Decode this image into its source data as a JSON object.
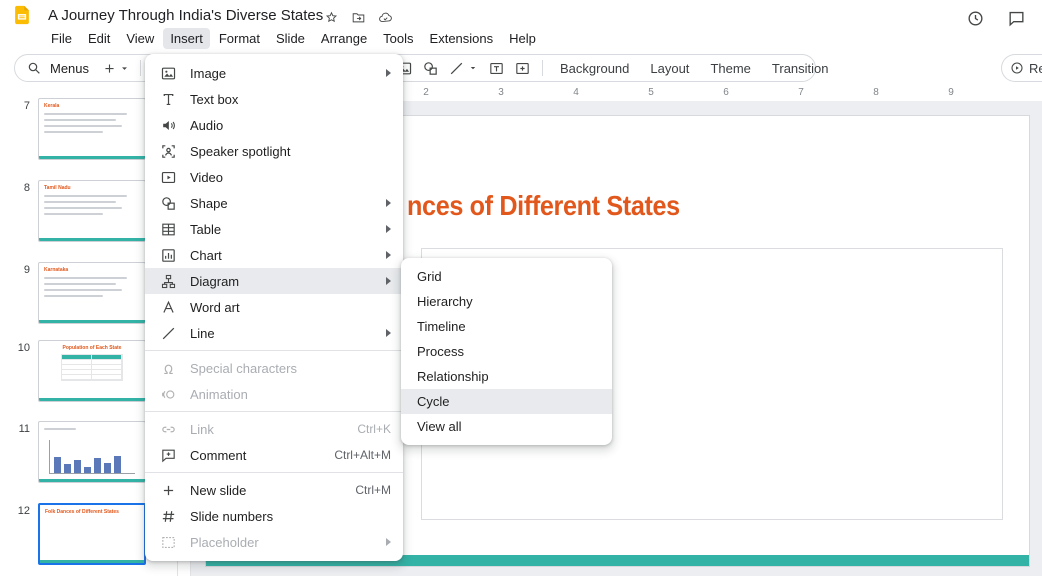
{
  "titlebar": {
    "title": "A Journey Through India's Diverse States"
  },
  "menubar": {
    "items": [
      "File",
      "Edit",
      "View",
      "Insert",
      "Format",
      "Slide",
      "Arrange",
      "Tools",
      "Extensions",
      "Help"
    ],
    "open_item": "Insert"
  },
  "toolbar": {
    "menus_label": "Menus",
    "background_label": "Background",
    "layout_label": "Layout",
    "theme_label": "Theme",
    "transition_label": "Transition",
    "rec_label": "Re"
  },
  "ruler": {
    "labels": [
      "2",
      "3",
      "4",
      "5",
      "6",
      "7",
      "8",
      "9"
    ]
  },
  "filmstrip": {
    "slides": [
      {
        "number": "7",
        "title": "Kerala",
        "layout": "text"
      },
      {
        "number": "8",
        "title": "Tamil Nadu",
        "layout": "text"
      },
      {
        "number": "9",
        "title": "Karnataka",
        "layout": "text"
      },
      {
        "number": "10",
        "title": "Population of Each State",
        "layout": "table"
      },
      {
        "number": "11",
        "title": "",
        "layout": "chart",
        "bars": [
          16,
          9,
          13,
          6,
          15,
          10,
          17
        ]
      },
      {
        "number": "12",
        "title": "Folk Dances of Different States",
        "layout": "title-only",
        "selected": true
      }
    ]
  },
  "slide_canvas": {
    "visible_title": "nces of Different States"
  },
  "insert_menu": {
    "items": [
      {
        "label": "Image",
        "icon": "image",
        "submenu": true
      },
      {
        "label": "Text box",
        "icon": "text-box"
      },
      {
        "label": "Audio",
        "icon": "audio"
      },
      {
        "label": "Speaker spotlight",
        "icon": "speaker-spotlight"
      },
      {
        "label": "Video",
        "icon": "video"
      },
      {
        "label": "Shape",
        "icon": "shape",
        "submenu": true
      },
      {
        "label": "Table",
        "icon": "table",
        "submenu": true
      },
      {
        "label": "Chart",
        "icon": "chart",
        "submenu": true
      },
      {
        "label": "Diagram",
        "icon": "diagram",
        "submenu": true,
        "highlighted": true
      },
      {
        "label": "Word art",
        "icon": "word-art"
      },
      {
        "label": "Line",
        "icon": "line",
        "submenu": true
      },
      {
        "divider": true
      },
      {
        "label": "Special characters",
        "icon": "omega",
        "disabled": true
      },
      {
        "label": "Animation",
        "icon": "animation",
        "disabled": true
      },
      {
        "divider": true
      },
      {
        "label": "Link",
        "icon": "link",
        "shortcut": "Ctrl+K",
        "disabled": true
      },
      {
        "label": "Comment",
        "icon": "comment",
        "shortcut": "Ctrl+Alt+M"
      },
      {
        "divider": true
      },
      {
        "label": "New slide",
        "icon": "plus",
        "shortcut": "Ctrl+M"
      },
      {
        "label": "Slide numbers",
        "icon": "hash"
      },
      {
        "label": "Placeholder",
        "icon": "placeholder",
        "submenu": true,
        "disabled": true
      }
    ]
  },
  "diagram_submenu": {
    "items": [
      "Grid",
      "Hierarchy",
      "Timeline",
      "Process",
      "Relationship",
      "Cycle",
      "View all"
    ],
    "highlighted": "Cycle"
  },
  "colors": {
    "accent_teal": "#33b3a6",
    "title_orange": "#e2581c",
    "selection_blue": "#1a73e8",
    "logo_yellow": "#FBBC04"
  }
}
